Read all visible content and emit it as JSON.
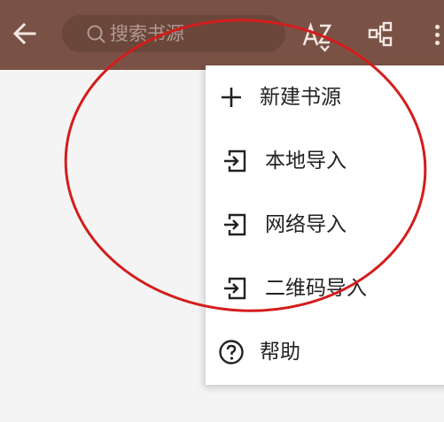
{
  "toolbar": {
    "background": "#7a5245",
    "back_icon": "arrow-left-icon",
    "search": {
      "placeholder": "搜索书源",
      "value": "",
      "icon": "search-icon"
    },
    "sort_icon": "sort-az-icon",
    "group_icon": "group-tree-icon",
    "more_icon": "more-vertical-icon"
  },
  "menu": {
    "items": [
      {
        "label": "新建书源",
        "icon": "plus-icon"
      },
      {
        "label": "本地导入",
        "icon": "import-icon"
      },
      {
        "label": "网络导入",
        "icon": "import-icon"
      },
      {
        "label": "二维码导入",
        "icon": "import-icon"
      },
      {
        "label": "帮助",
        "icon": "help-circle-icon"
      }
    ]
  },
  "annotation": {
    "shape": "ellipse",
    "color": "#d41c1c"
  }
}
